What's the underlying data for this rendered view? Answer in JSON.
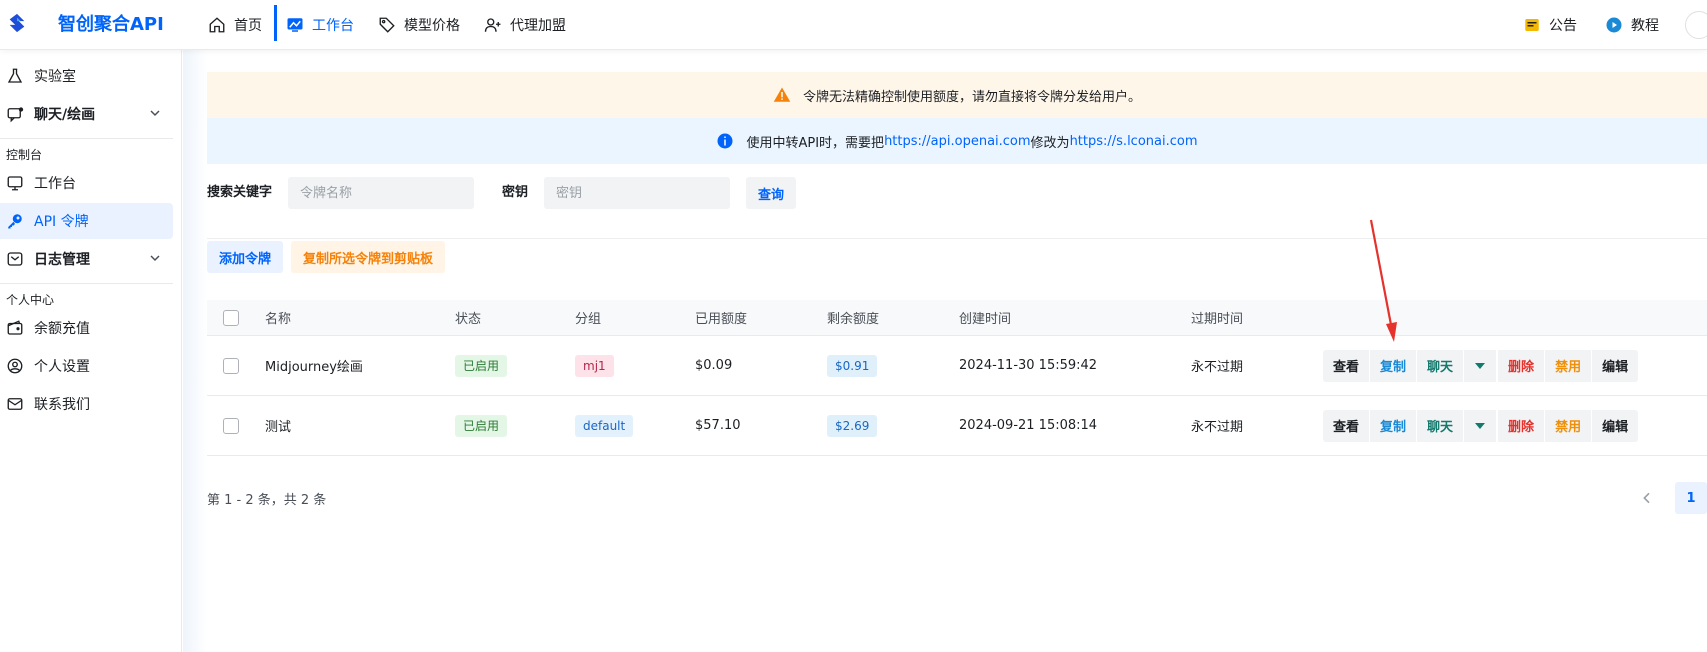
{
  "app": {
    "brand": "智创聚合API"
  },
  "nav": {
    "items": [
      {
        "label": "首页",
        "icon": "home-icon"
      },
      {
        "label": "工作台",
        "icon": "workbench-icon",
        "active": true
      },
      {
        "label": "模型价格",
        "icon": "price-tag-icon"
      },
      {
        "label": "代理加盟",
        "icon": "user-add-icon"
      }
    ],
    "right": [
      {
        "label": "公告",
        "icon": "announcement-icon"
      },
      {
        "label": "教程",
        "icon": "play-icon"
      }
    ]
  },
  "sidebar": {
    "top_items": [
      {
        "label": "实验室",
        "icon": "flask-icon"
      },
      {
        "label": "聊天/绘画",
        "icon": "chat-icon",
        "bold": true,
        "expandable": true
      }
    ],
    "group_console": "控制台",
    "console_items": [
      {
        "label": "工作台",
        "icon": "monitor-icon"
      },
      {
        "label": "API 令牌",
        "icon": "key-icon",
        "active": true
      },
      {
        "label": "日志管理",
        "icon": "log-icon",
        "bold": true,
        "expandable": true
      }
    ],
    "group_personal": "个人中心",
    "personal_items": [
      {
        "label": "余额充值",
        "icon": "wallet-icon"
      },
      {
        "label": "个人设置",
        "icon": "user-icon"
      },
      {
        "label": "联系我们",
        "icon": "mail-icon"
      }
    ]
  },
  "banners": {
    "warning": "令牌无法精确控制使用额度，请勿直接将令牌分发给用户。",
    "info_prefix": "使用中转API时，需要把",
    "info_link1": "https://api.openai.com",
    "info_middle": "修改为",
    "info_link2": "https://s.lconai.com"
  },
  "search": {
    "keyword_label": "搜索关键字",
    "keyword_placeholder": "令牌名称",
    "key_label": "密钥",
    "key_placeholder": "密钥",
    "query_button": "查询"
  },
  "actions": {
    "add": "添加令牌",
    "copy_selected": "复制所选令牌到剪贴板"
  },
  "table": {
    "headers": {
      "name": "名称",
      "status": "状态",
      "group": "分组",
      "used": "已用额度",
      "remain": "剩余额度",
      "created": "创建时间",
      "expire": "过期时间"
    },
    "ops": {
      "view": "查看",
      "copy": "复制",
      "chat": "聊天",
      "delete": "删除",
      "disable": "禁用",
      "edit": "编辑"
    },
    "rows": [
      {
        "name": "Midjourney绘画",
        "status": "已启用",
        "group": "mj1",
        "used": "$0.09",
        "remain": "$0.91",
        "created": "2024-11-30 15:59:42",
        "expire": "永不过期"
      },
      {
        "name": "测试",
        "status": "已启用",
        "group": "default",
        "used": "$57.10",
        "remain": "$2.69",
        "created": "2024-09-21 15:08:14",
        "expire": "永不过期"
      }
    ]
  },
  "footer": {
    "summary": "第 1 - 2 条，共 2 条",
    "current_page": "1"
  },
  "colors": {
    "primary": "#0064fa",
    "warning_bg": "#fff6ea",
    "info_bg": "#eaf5ff",
    "annotation_arrow": "#e5322d"
  }
}
